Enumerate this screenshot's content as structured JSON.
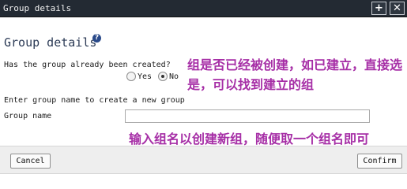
{
  "window": {
    "title": "Group details",
    "buttons": [
      "+",
      "✕"
    ]
  },
  "form": {
    "heading": "Group details",
    "help_icon": "?",
    "question": "Has the group already been created?",
    "radio_yes": "Yes",
    "radio_no": "No",
    "selected": "No",
    "create_hint": "Enter group name to create a new group",
    "group_name_label": "Group name",
    "group_name_value": ""
  },
  "annotations": {
    "note1": "组是否已经被创建，如已建立，直接选是，可以找到建立的组",
    "note2": "输入组名以创建新组，随便取一个组名即可"
  },
  "footer": {
    "cancel_label": "Cancel",
    "confirm_label": "Confirm"
  }
}
